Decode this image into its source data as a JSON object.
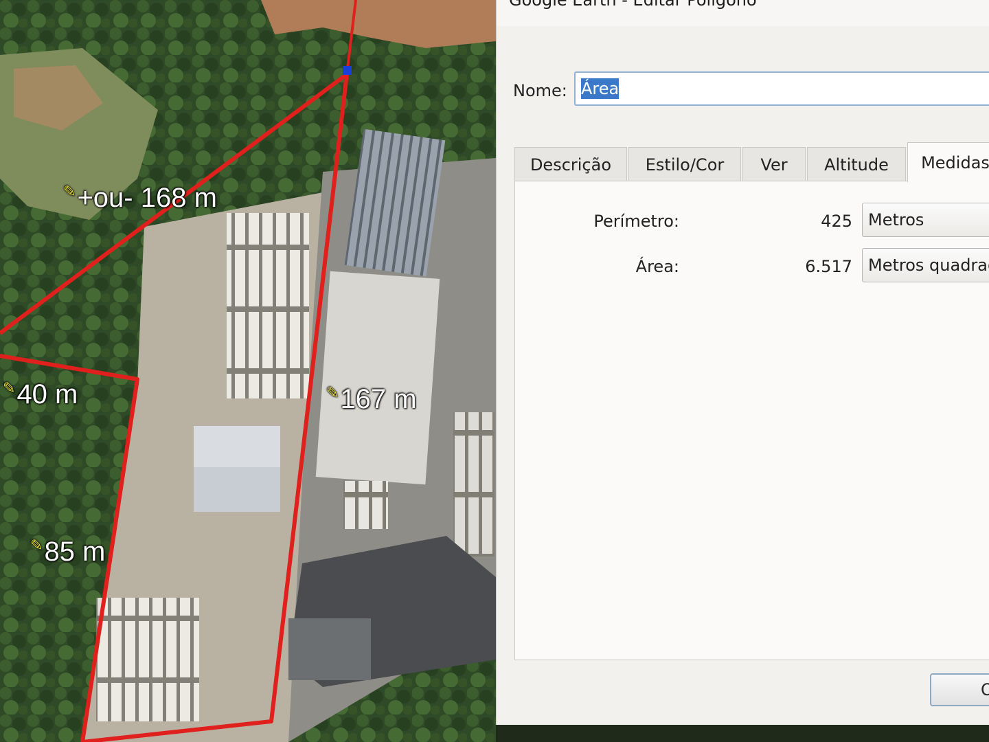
{
  "map": {
    "measurements": [
      {
        "text": "+ou- 168 m"
      },
      {
        "text": "40 m"
      },
      {
        "text": "167 m"
      },
      {
        "text": "85 m"
      }
    ],
    "colors": {
      "polygon": "#e0201c",
      "vertex": "#1a3fd8",
      "label": "#ffffff"
    }
  },
  "dialog": {
    "title": "Google Earth - Editar Polígono",
    "name_label": "Nome:",
    "name_value": "Área",
    "tabs": [
      {
        "label": "Descrição"
      },
      {
        "label": "Estilo/Cor"
      },
      {
        "label": "Ver"
      },
      {
        "label": "Altitude"
      },
      {
        "label": "Medidas",
        "active": true
      }
    ],
    "measures": {
      "perimeter_label": "Perímetro:",
      "perimeter_value": "425",
      "perimeter_unit": "Metros",
      "area_label": "Área:",
      "area_value": "6.517",
      "area_unit": "Metros quadrados"
    },
    "ok_label": "OK",
    "colors": {
      "selection": "#3b78c9",
      "input_border": "#8fb1d6"
    }
  }
}
